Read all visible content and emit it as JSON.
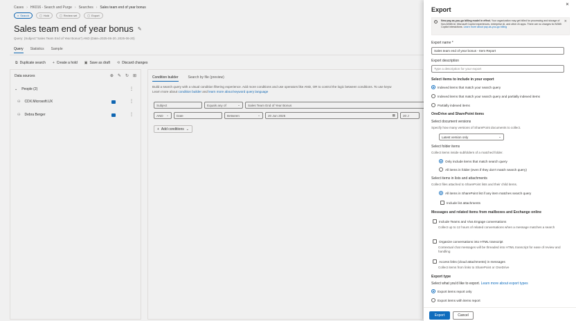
{
  "breadcrumb": [
    "Cases",
    "HK016 - Search and Purge",
    "Searches",
    "Sales team end of year bonus"
  ],
  "toolbar": {
    "search": "Search",
    "hold": "Hold",
    "review": "Review set",
    "export": "Export"
  },
  "page": {
    "title": "Sales team end of year bonus",
    "query": "Query: (Subject:\"Sales Team End of Year Bonus\") AND (Date=2025-06-20..2025-06-20)"
  },
  "tabs": [
    "Query",
    "Statistics",
    "Sample"
  ],
  "actions": {
    "duplicate": "Duplicate search",
    "hold": "Create a hold",
    "save": "Save as draft",
    "discard": "Discard changes"
  },
  "data_sources": {
    "title": "Data sources",
    "people": "People (2)",
    "items": [
      "CDX.Microsoft.UX",
      "Debra Berger"
    ]
  },
  "condition_builder": {
    "tab_active": "Condition builder",
    "tab_other": "Search by file (preview)",
    "desc1": "Build a search query with a visual condition filtering experience. Add more conditions and use operators like AND, OR to control the logic between conditions. To use keyw",
    "desc2_prefix": "Learn more about ",
    "desc2_link1": "condition builder",
    "desc2_mid": " and ",
    "desc2_link2": "learn more about keyword query language",
    "row1": {
      "field": "Subject",
      "op": "Equals any of",
      "value": "Sales Team End of Year Bonus"
    },
    "row2": {
      "logic": "AND",
      "field": "Date",
      "op": "Between",
      "value": "20 Jun 2025",
      "value2": "20 J"
    },
    "add": "Add conditions"
  },
  "panel": {
    "title": "Export",
    "info": {
      "bold": "New pay-as-you-go billing model in effect.",
      "text": " Your organization may get billed for processing and storage of Non-M365 AI, Microsoft Copilot experiences, enterprise AI, and other AI apps. There are no charges for M365 Copilot interactions. ",
      "link": "Learn more about pay-as-you-go billing"
    },
    "name_label": "Export name *",
    "name_value": "Sales team end of year bonus - Item Report",
    "desc_label": "Export description",
    "desc_placeholder": "Type a description for your export",
    "select_items_label": "Select items to include in your export",
    "select_items": [
      "Indexed items that match your search query",
      "Indexed items that match your search query and partially indexed items",
      "Partially indexed items"
    ],
    "onedrive_title": "OneDrive and SharePoint items",
    "doc_versions_label": "Select document versions",
    "doc_versions_desc": "Specify how many versions of SharePoint documents to collect.",
    "doc_versions_value": "Latest version only",
    "folder_label": "Select folder items",
    "folder_desc": "Collect items inside subfolders of a matched folder.",
    "folder_opts": [
      "Only include items that match search query",
      "All items in folder (even if they don't match search query)"
    ],
    "lists_label": "Select items in lists and attachments",
    "lists_desc": "Collect files attached to SharePoint lists and their child items.",
    "lists_opt": "All items in SharePoint list if any item matches search query",
    "list_attach": "Include list attachments",
    "messages_title": "Messages and related items from mailboxes and Exchange online",
    "teams_label": "Include Teams and Viva Engage conversations",
    "teams_desc": "Collect up to 12 hours of related conversations when a message matches a search",
    "html_label": "Organize conversations into HTML transcript",
    "html_desc": "Contextual chat messages will be threaded into HTML transcript for ease of review and handling",
    "links_label": "Access links (cloud attachments) in messages",
    "links_desc": "Collect items from links to SharePoint or OneDrive",
    "export_type_label": "Export type",
    "export_type_desc": "Select what you'd like to export. ",
    "export_type_link": "Learn more about export types",
    "export_types": [
      "Export items report only",
      "Export items with items report"
    ],
    "export_btn": "Export",
    "cancel_btn": "Cancel"
  }
}
